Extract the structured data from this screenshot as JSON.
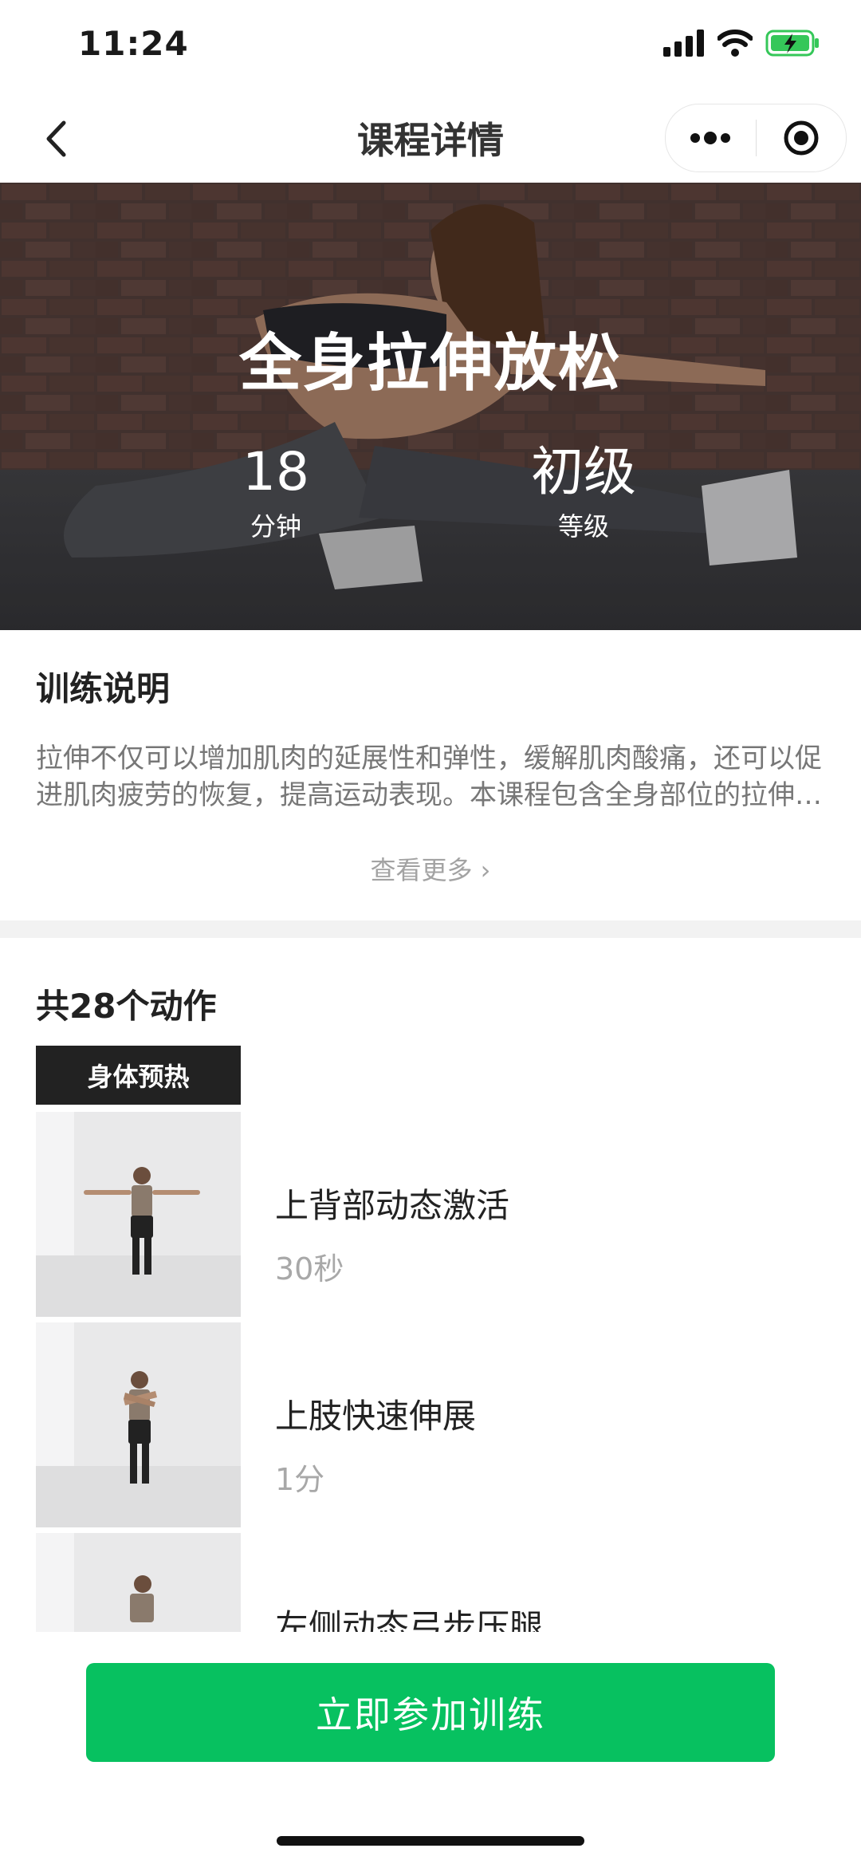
{
  "status_bar": {
    "time": "11:24"
  },
  "nav": {
    "title": "课程详情"
  },
  "hero": {
    "title": "全身拉伸放松",
    "duration_value": "18",
    "duration_label": "分钟",
    "level_value": "初级",
    "level_label": "等级"
  },
  "description": {
    "title": "训练说明",
    "text": "拉伸不仅可以增加肌肉的延展性和弹性，缓解肌肉酸痛，还可以促进肌肉疲劳的恢复，提高运动表现。本课程包含全身部位的拉伸…",
    "see_more": "查看更多 ›"
  },
  "exercises": {
    "count_label": "共28个动作",
    "group_label": "身体预热",
    "items": [
      {
        "name": "上背部动态激活",
        "duration": "30秒"
      },
      {
        "name": "上肢快速伸展",
        "duration": "1分"
      },
      {
        "name": "左侧动态弓步压腿",
        "duration": ""
      }
    ]
  },
  "action": {
    "join_label": "立即参加训练"
  },
  "colors": {
    "accent": "#07c160",
    "tag_bg": "#222222",
    "battery": "#35c759"
  },
  "icons": [
    "back-arrow-icon",
    "more-dots-icon",
    "target-icon",
    "signal-icon",
    "wifi-icon",
    "battery-icon"
  ]
}
